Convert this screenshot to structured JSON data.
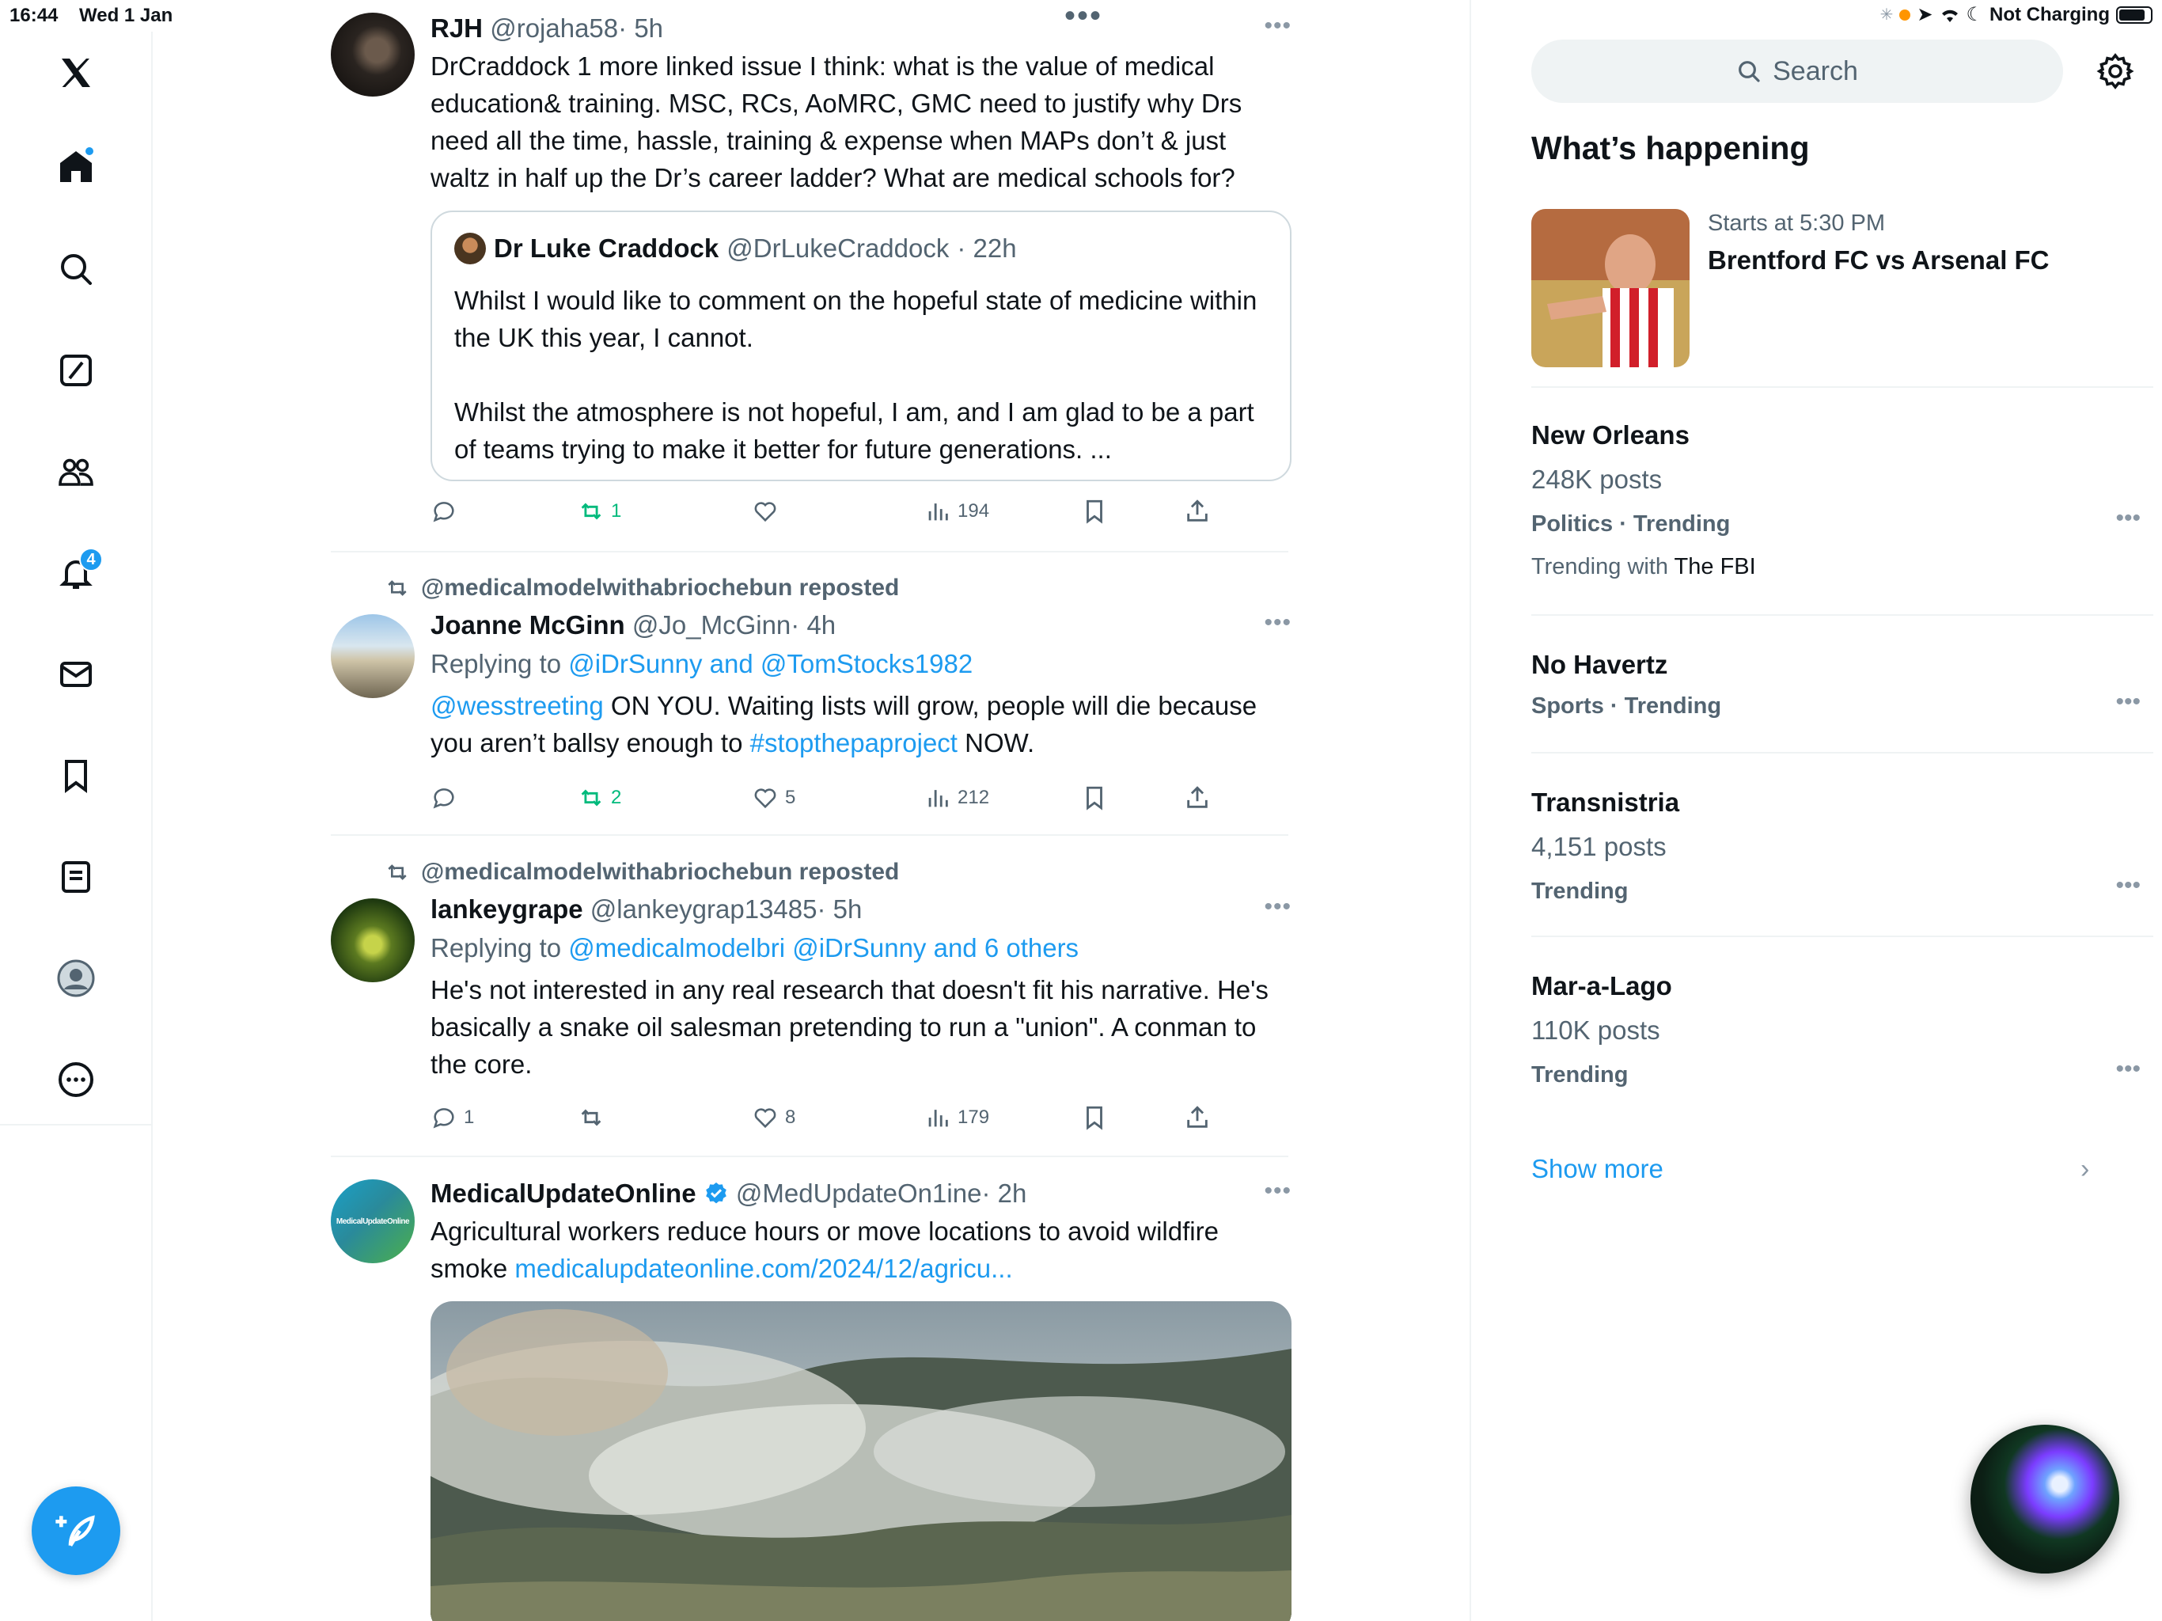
{
  "status_bar": {
    "time": "16:44",
    "date": "Wed 1 Jan",
    "battery_text": "Not Charging"
  },
  "nav": {
    "notifications_badge": "4",
    "items": [
      "x-logo",
      "home",
      "search",
      "grok",
      "communities",
      "notifications",
      "messages",
      "bookmarks",
      "lists",
      "profile",
      "more"
    ]
  },
  "tweets": [
    {
      "name": "RJH",
      "handle": "@rojaha58",
      "time": "· 5h",
      "text": "DrCraddock 1 more linked issue I think: what is the value of medical education& training. MSC, RCs, AoMRC, GMC need to justify why Drs need all the time, hassle, training & expense when MAPs don’t & just waltz in half up the Dr’s career ladder? What are medical schools for?",
      "quote": {
        "name": "Dr Luke Craddock",
        "handle": "@DrLukeCraddock",
        "time": "· 22h",
        "text_1": "Whilst I would like to comment on the hopeful state of medicine within the UK this year, I cannot.",
        "text_2": "Whilst the atmosphere is not hopeful, I am, and I am glad to be a part of teams trying to make it better for future generations. ..."
      },
      "replies": "",
      "reposts": "1",
      "likes": "",
      "views": "194"
    },
    {
      "reposted_by": "@medicalmodelwithabriochebun reposted",
      "name": "Joanne McGinn",
      "handle": "@Jo_McGinn",
      "time": "· 4h",
      "replying_prefix": "Replying to ",
      "replying_to": "@iDrSunny and @TomStocks1982",
      "mention": "@wesstreeting",
      "text_a": " ON YOU. Waiting lists will grow, people will die because you aren’t ballsy enough to ",
      "hashtag": "#stopthepaproject",
      "text_b": " NOW.",
      "replies": "",
      "reposts": "2",
      "likes": "5",
      "views": "212"
    },
    {
      "reposted_by": "@medicalmodelwithabriochebun reposted",
      "name": "lankeygrape",
      "handle": "@lankeygrap13485",
      "time": "· 5h",
      "replying_prefix": "Replying to ",
      "replying_to": "@medicalmodelbri @iDrSunny and 6 others",
      "text": "He's not interested in any real research that doesn't fit his narrative. He's basically a snake oil salesman pretending to run a \"union\". A conman to the core.",
      "replies": "1",
      "reposts": "",
      "likes": "8",
      "views": "179"
    },
    {
      "name": "MedicalUpdateOnline",
      "handle": "@MedUpdateOn1ine",
      "time": "· 2h",
      "avatar_text": "MedicalUpdateOnline",
      "text": "Agricultural workers reduce hours or move locations to avoid wildfire smoke ",
      "link": "medicalupdateonline.com/2024/12/agricu..."
    }
  ],
  "sidebar": {
    "search_placeholder": "Search",
    "whats_happening": "What’s happening",
    "event": {
      "time": "Starts at 5:30 PM",
      "title": "Brentford FC vs Arsenal FC"
    },
    "trends": [
      {
        "title": "New Orleans",
        "count": "248K posts",
        "category": "Politics · Trending",
        "with_prefix": "Trending with ",
        "with": "The FBI"
      },
      {
        "title": "No Havertz",
        "category": "Sports · Trending"
      },
      {
        "title": "Transnistria",
        "count": "4,151 posts",
        "category": "Trending"
      },
      {
        "title": "Mar-a-Lago",
        "count": "110K posts",
        "category": "Trending"
      }
    ],
    "show_more": "Show more"
  },
  "colors": {
    "accent": "#1d9bf0",
    "repost_green": "#00ba7c",
    "secondary_text": "#536471",
    "border": "#eff3f4"
  }
}
